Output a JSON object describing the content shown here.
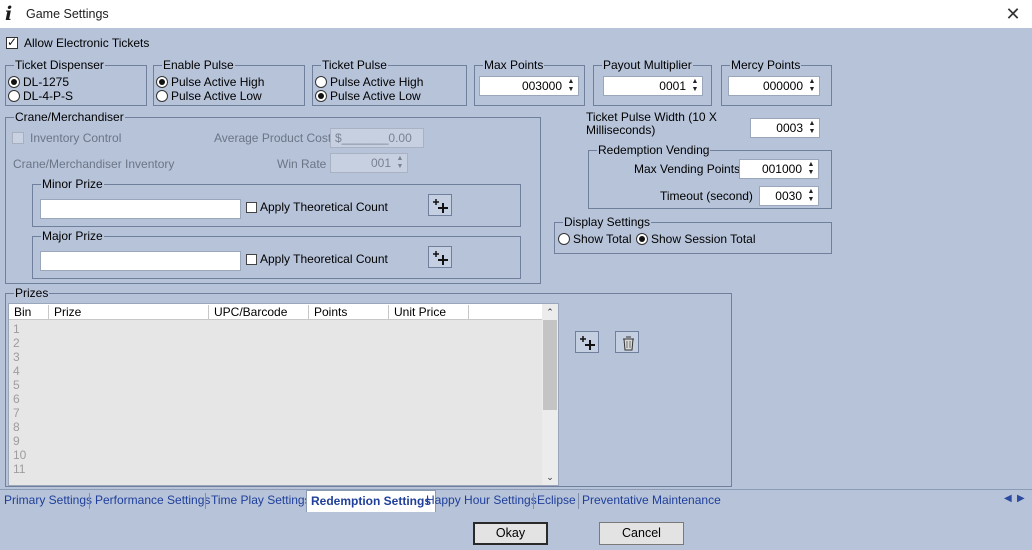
{
  "window": {
    "title": "Game Settings",
    "app_icon": "info-i-icon",
    "close_glyph": "✕"
  },
  "allow_electronic_tickets": {
    "label": "Allow Electronic Tickets",
    "checked": true
  },
  "ticket_dispenser": {
    "label": "Ticket Dispenser",
    "options": [
      "DL-1275",
      "DL-4-P-S"
    ],
    "selected": "DL-1275"
  },
  "enable_pulse": {
    "label": "Enable Pulse",
    "options": [
      "Pulse Active High",
      "Pulse Active Low"
    ],
    "selected": "Pulse Active High"
  },
  "ticket_pulse": {
    "label": "Ticket Pulse",
    "options": [
      "Pulse Active High",
      "Pulse Active Low"
    ],
    "selected": "Pulse Active Low"
  },
  "max_points": {
    "label": "Max Points",
    "value": "003000"
  },
  "payout_multiplier": {
    "label": "Payout Multiplier",
    "value": "0001"
  },
  "mercy_points": {
    "label": "Mercy Points",
    "value": "000000"
  },
  "crane": {
    "label": "Crane/Merchandiser",
    "inventory_control": "Inventory Control",
    "average_product_cost_label": "Average Product Cost",
    "average_product_cost_value": "$_______0.00",
    "inventory_label": "Crane/Merchandiser Inventory",
    "win_rate_label": "Win Rate",
    "win_rate_value": "001",
    "minor_prize": {
      "label": "Minor Prize",
      "value": "",
      "apply_label": "Apply Theoretical Count"
    },
    "major_prize": {
      "label": "Major Prize",
      "value": "",
      "apply_label": "Apply Theoretical Count"
    }
  },
  "ticket_pulse_width": {
    "label_line1": "Ticket Pulse Width (10 X",
    "label_line2": "Milliseconds)",
    "value": "0003"
  },
  "redemption_vending": {
    "label": "Redemption Vending",
    "max_vending_points_label": "Max Vending Points",
    "max_vending_points_value": "001000",
    "timeout_label": "Timeout (second)",
    "timeout_value": "0030"
  },
  "display_settings": {
    "label": "Display Settings",
    "options": [
      "Show Total",
      "Show Session Total"
    ],
    "selected": "Show Session Total"
  },
  "prizes": {
    "label": "Prizes",
    "columns": [
      "Bin",
      "Prize",
      "UPC/Barcode",
      "Points",
      "Unit Price"
    ],
    "rows": [
      "1",
      "2",
      "3",
      "4",
      "5",
      "6",
      "7",
      "8",
      "9",
      "10",
      "11"
    ]
  },
  "tabs": [
    "Primary Settings",
    "Performance Settings",
    "Time Play Settings",
    "Redemption Settings",
    "Happy Hour Settings",
    "Eclipse",
    "Preventative Maintenance"
  ],
  "active_tab": "Redemption Settings",
  "tab_scroll": {
    "left": "◀",
    "right": "▶"
  },
  "buttons": {
    "okay": "Okay",
    "cancel": "Cancel"
  },
  "colors": {
    "client_bg": "#b6c3d9",
    "border": "#6f7f9c",
    "tab_text": "#1f3f9a"
  }
}
